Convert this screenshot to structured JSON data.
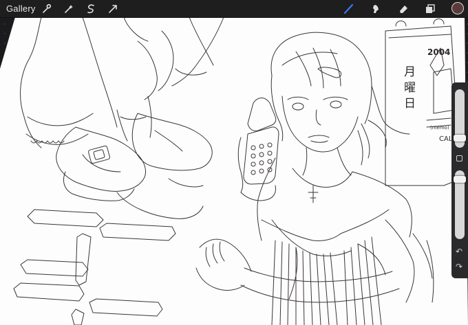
{
  "toolbar": {
    "gallery_label": "Gallery",
    "left_tools": [
      "wrench-icon",
      "magic-wand-icon",
      "selection-icon",
      "transform-arrow-icon"
    ],
    "right_tools": [
      "brush-icon",
      "smudge-icon",
      "eraser-icon",
      "layers-icon"
    ],
    "active_tool": "brush-icon",
    "accent_color": "#3a78f2",
    "current_color": "#5a3a3a"
  },
  "canvas": {
    "calendar_year": "2004",
    "calendar_weekday_chars": [
      "月",
      "曜",
      "日"
    ],
    "calendar_note": "(memo)",
    "calendar_cal_text": "CALL"
  },
  "side_panel": {
    "undo_symbol": "↶",
    "redo_symbol": "↷"
  }
}
